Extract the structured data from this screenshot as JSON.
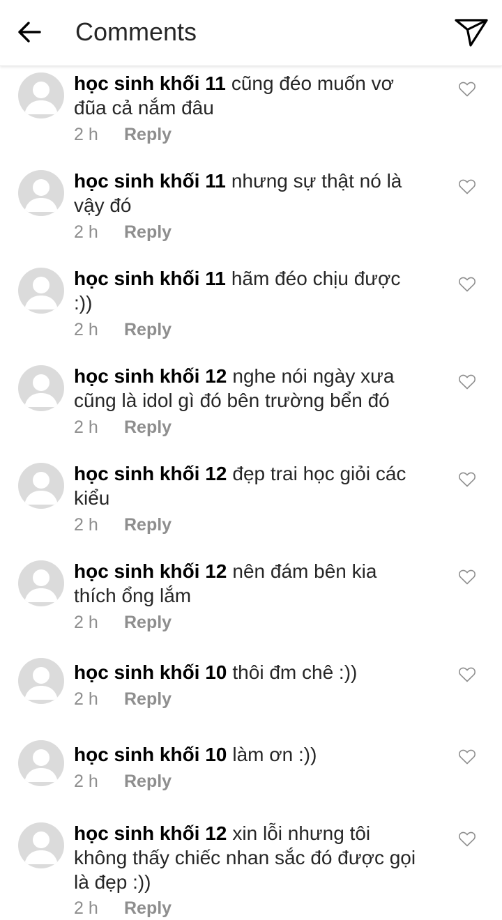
{
  "header": {
    "title": "Comments",
    "back_icon": "arrow-left-icon",
    "share_icon": "paper-plane-icon"
  },
  "comments": [
    {
      "user": "học sinh khối 11",
      "text": "cũng đéo muốn vơ đũa cả nắm đâu",
      "time": "2 h",
      "reply": "Reply"
    },
    {
      "user": "học sinh khối 11",
      "text": "nhưng sự thật nó là vậy đó",
      "time": "2 h",
      "reply": "Reply"
    },
    {
      "user": "học sinh khối 11",
      "text": "hãm đéo chịu được :))",
      "time": "2 h",
      "reply": "Reply"
    },
    {
      "user": "học sinh khối 12",
      "text": "nghe nói ngày xưa cũng là idol gì đó bên trường bển đó",
      "time": "2 h",
      "reply": "Reply"
    },
    {
      "user": "học sinh khối 12",
      "text": "đẹp trai học giỏi các kiểu",
      "time": "2 h",
      "reply": "Reply"
    },
    {
      "user": "học sinh khối 12",
      "text": "nên đám bên kia thích ổng lắm",
      "time": "2 h",
      "reply": "Reply"
    },
    {
      "user": "học sinh khối 10",
      "text": "thôi đm chê :))",
      "time": "2 h",
      "reply": "Reply"
    },
    {
      "user": "học sinh khối 10",
      "text": "làm ơn :))",
      "time": "2 h",
      "reply": "Reply"
    },
    {
      "user": "học sinh khối 12",
      "text": "xin lỗi nhưng tôi không thấy chiếc nhan sắc đó được gọi là đẹp :))",
      "time": "2 h",
      "reply": "Reply"
    }
  ],
  "icons": {
    "avatar": "default-avatar-icon",
    "like": "heart-outline-icon"
  },
  "colors": {
    "text": "#262626",
    "meta": "#8e8e8e",
    "avatar_bg": "#dbdbdb"
  }
}
